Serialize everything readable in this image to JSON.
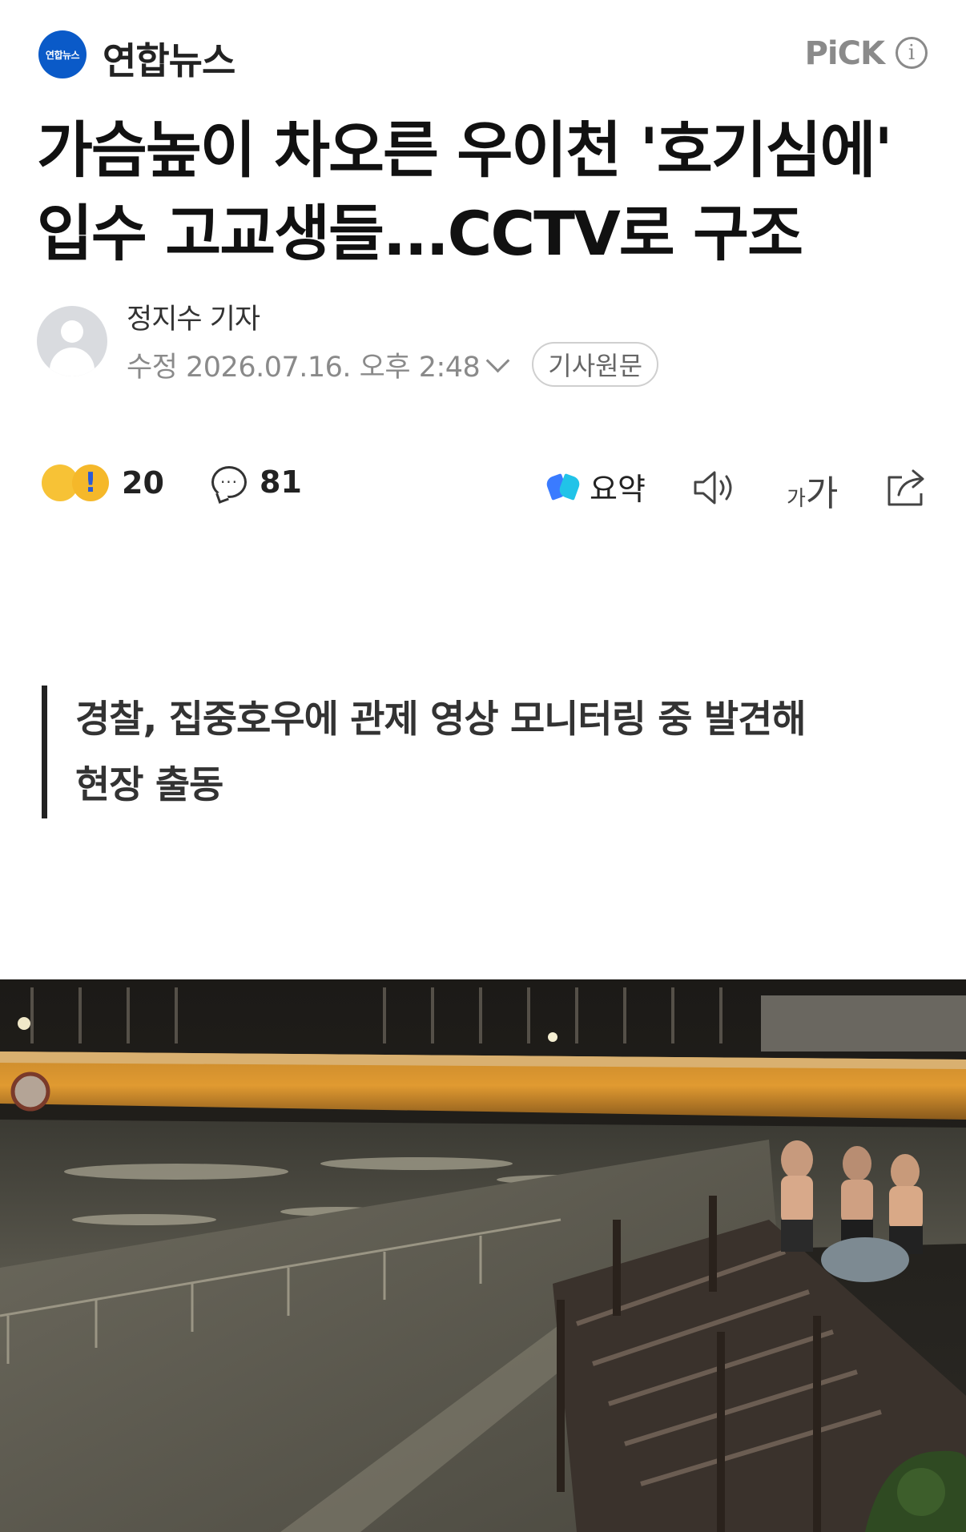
{
  "header": {
    "logo_badge": "연합뉴스",
    "publisher": "연합뉴스",
    "pick_label": "PiCK",
    "info_glyph": "i"
  },
  "article": {
    "title_line1": "가슴높이 차오른 우이천 '호기심에'",
    "title_line2": "입수 고교생들...CCTV로 구조",
    "reporter": "정지수 기자",
    "date": "수정 2026.07.16. 오후 2:48",
    "original_button": "기사원문",
    "subhead_line1": "경찰, 집중호우에 관제 영상 모니터링 중 발견해",
    "subhead_line2": "현장 출동"
  },
  "actions": {
    "reaction_count": "20",
    "comment_count": "81",
    "summary_label": "요약",
    "font_small": "가",
    "font_large": "가"
  },
  "colors": {
    "logo_blue": "#0a5ac8",
    "muted_gray": "#8a8a8a"
  },
  "icons": {
    "reaction": "thumbs-up-exclaim-icon",
    "comment": "comment-bubble-icon",
    "summary": "ai-summary-icon",
    "tts": "speaker-icon",
    "share": "share-icon",
    "info": "info-icon"
  }
}
